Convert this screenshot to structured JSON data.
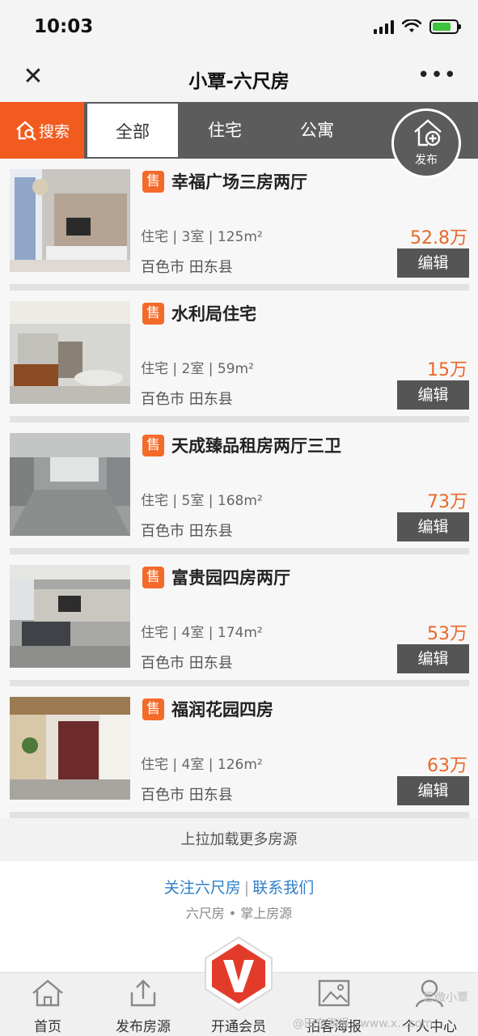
{
  "status_bar": {
    "time": "10:03"
  },
  "nav": {
    "title": "小覃-六尺房",
    "close_icon": "close-icon",
    "more_icon": "more-icon"
  },
  "tabs": {
    "search_label": "搜索",
    "items": [
      {
        "label": "全部",
        "active": true
      },
      {
        "label": "住宅",
        "active": false
      },
      {
        "label": "公寓",
        "active": false
      }
    ],
    "publish_label": "发布"
  },
  "listings": [
    {
      "badge": "售",
      "title": "幸福广场三房两厅",
      "specs": "住宅 | 3室 | 125m²",
      "location": "百色市 田东县",
      "price": "52.8万",
      "edit_label": "编辑"
    },
    {
      "badge": "售",
      "title": "水利局住宅",
      "specs": "住宅 | 2室 | 59m²",
      "location": "百色市 田东县",
      "price": "15万",
      "edit_label": "编辑"
    },
    {
      "badge": "售",
      "title": "天成臻品租房两厅三卫",
      "specs": "住宅 | 5室 | 168m²",
      "location": "百色市 田东县",
      "price": "73万",
      "edit_label": "编辑"
    },
    {
      "badge": "售",
      "title": "富贵园四房两厅",
      "specs": "住宅 | 4室 | 174m²",
      "location": "百色市 田东县",
      "price": "53万",
      "edit_label": "编辑"
    },
    {
      "badge": "售",
      "title": "福润花园四房",
      "specs": "住宅 | 4室 | 126m²",
      "location": "百色市 田东县",
      "price": "63万",
      "edit_label": "编辑"
    }
  ],
  "load_more": "上拉加载更多房源",
  "footer": {
    "follow": "关注六尺房",
    "separator": "|",
    "contact": "联系我们",
    "tagline": "六尺房 • 掌上房源"
  },
  "bottom_nav": {
    "items": [
      {
        "label": "首页",
        "icon": "home-icon"
      },
      {
        "label": "发布房源",
        "icon": "upload-icon"
      },
      {
        "label": "开通会员",
        "icon": "vip-badge-icon"
      },
      {
        "label": "拍客海报",
        "icon": "image-icon"
      },
      {
        "label": "个人中心",
        "icon": "user-icon"
      }
    ]
  },
  "watermark": {
    "line1": "思微小覃",
    "line2": "@田东海报 · www.x…com"
  },
  "colors": {
    "accent": "#f15b1f",
    "tab_bg": "#5c5c5c",
    "price": "#e8682a",
    "link": "#2e7fc9"
  }
}
